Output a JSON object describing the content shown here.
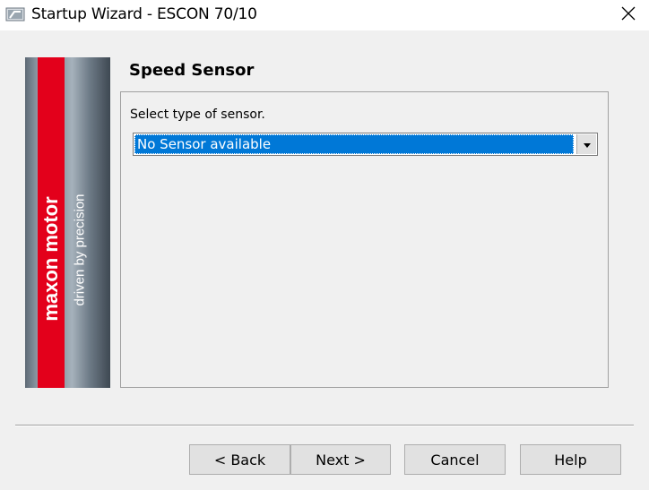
{
  "window": {
    "title": "Startup Wizard - ESCON 70/10"
  },
  "banner": {
    "brand": "maxon motor",
    "tagline": "driven by precision",
    "brand_color": "#e3001b"
  },
  "page": {
    "heading": "Speed Sensor",
    "prompt": "Select type of sensor.",
    "sensor_select": {
      "selected": "No Sensor available"
    }
  },
  "buttons": {
    "back": "< Back",
    "next": "Next >",
    "cancel": "Cancel",
    "help": "Help"
  },
  "colors": {
    "selection": "#0078d7",
    "window_bg": "#f0f0f0",
    "button_bg": "#e1e1e1"
  }
}
